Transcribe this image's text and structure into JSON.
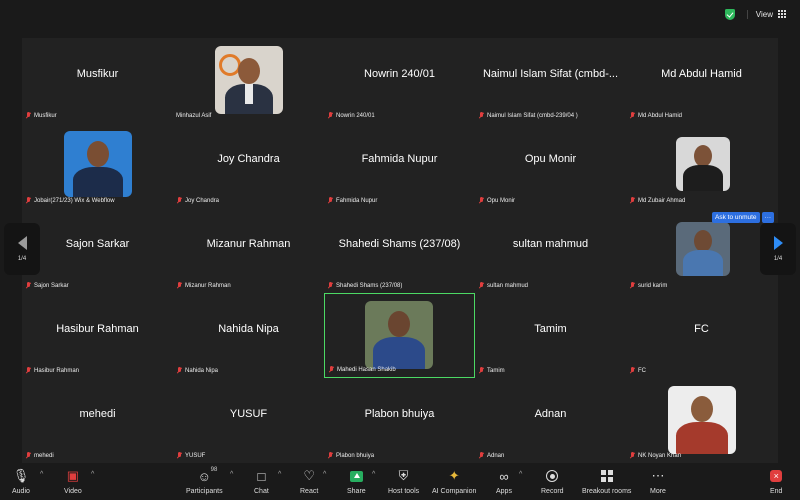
{
  "topbar": {
    "view_label": "View"
  },
  "pagination": {
    "left": "1/4",
    "right": "1/4"
  },
  "ask_to_unmute": {
    "label": "Ask to unmute",
    "more": "···"
  },
  "tiles": [
    {
      "big": "Musfikur",
      "label": "Musfikur"
    },
    {
      "big": "",
      "label": "Minhazul Asif"
    },
    {
      "big": "Nowrin 240/01",
      "label": "Nowrin 240/01"
    },
    {
      "big": "Naimul Islam Sifat (cmbd-...",
      "label": "Naimul Islam Sifat (cmbd-239/04 )"
    },
    {
      "big": "Md Abdul Hamid",
      "label": "Md Abdul Hamid"
    },
    {
      "big": "",
      "label": "Jobair(271/23) Wix & Webflow"
    },
    {
      "big": "Joy Chandra",
      "label": "Joy Chandra"
    },
    {
      "big": "Fahmida Nupur",
      "label": "Fahmida Nupur"
    },
    {
      "big": "Opu Monir",
      "label": "Opu Monir"
    },
    {
      "big": "",
      "label": "Md Zubair Ahmad"
    },
    {
      "big": "Sajon Sarkar",
      "label": "Sajon Sarkar"
    },
    {
      "big": "Mizanur Rahman",
      "label": "Mizanur Rahman"
    },
    {
      "big": "Shahedi Shams (237/08)",
      "label": "Shahedi Shams (237/08)"
    },
    {
      "big": "sultan mahmud",
      "label": "sultan mahmud"
    },
    {
      "big": "",
      "label": "surid karim"
    },
    {
      "big": "Hasibur Rahman",
      "label": "Hasibur Rahman"
    },
    {
      "big": "Nahida Nipa",
      "label": "Nahida Nipa"
    },
    {
      "big": "",
      "label": "Mahedi Hasan Shakib"
    },
    {
      "big": "Tamim",
      "label": "Tamim"
    },
    {
      "big": "FC",
      "label": "FC"
    },
    {
      "big": "mehedi",
      "label": "mehedi"
    },
    {
      "big": "YUSUF",
      "label": "YUSUF"
    },
    {
      "big": "Plabon bhuiya",
      "label": "Plabon bhuiya"
    },
    {
      "big": "Adnan",
      "label": "Adnan"
    },
    {
      "big": "",
      "label": "NK Noyan Khan"
    }
  ],
  "toolbar": {
    "audio": "Audio",
    "video": "Video",
    "participants": "Participants",
    "participants_count": "98",
    "chat": "Chat",
    "react": "React",
    "share": "Share",
    "host_tools": "Host tools",
    "ai_companion": "AI Companion",
    "apps": "Apps",
    "record": "Record",
    "breakout": "Breakout rooms",
    "more": "More",
    "end": "End"
  },
  "colors": {
    "active_speaker": "#4cd964",
    "share": "#27ae60",
    "end": "#e03e3e",
    "unmute_pill": "#2d6fe0"
  }
}
